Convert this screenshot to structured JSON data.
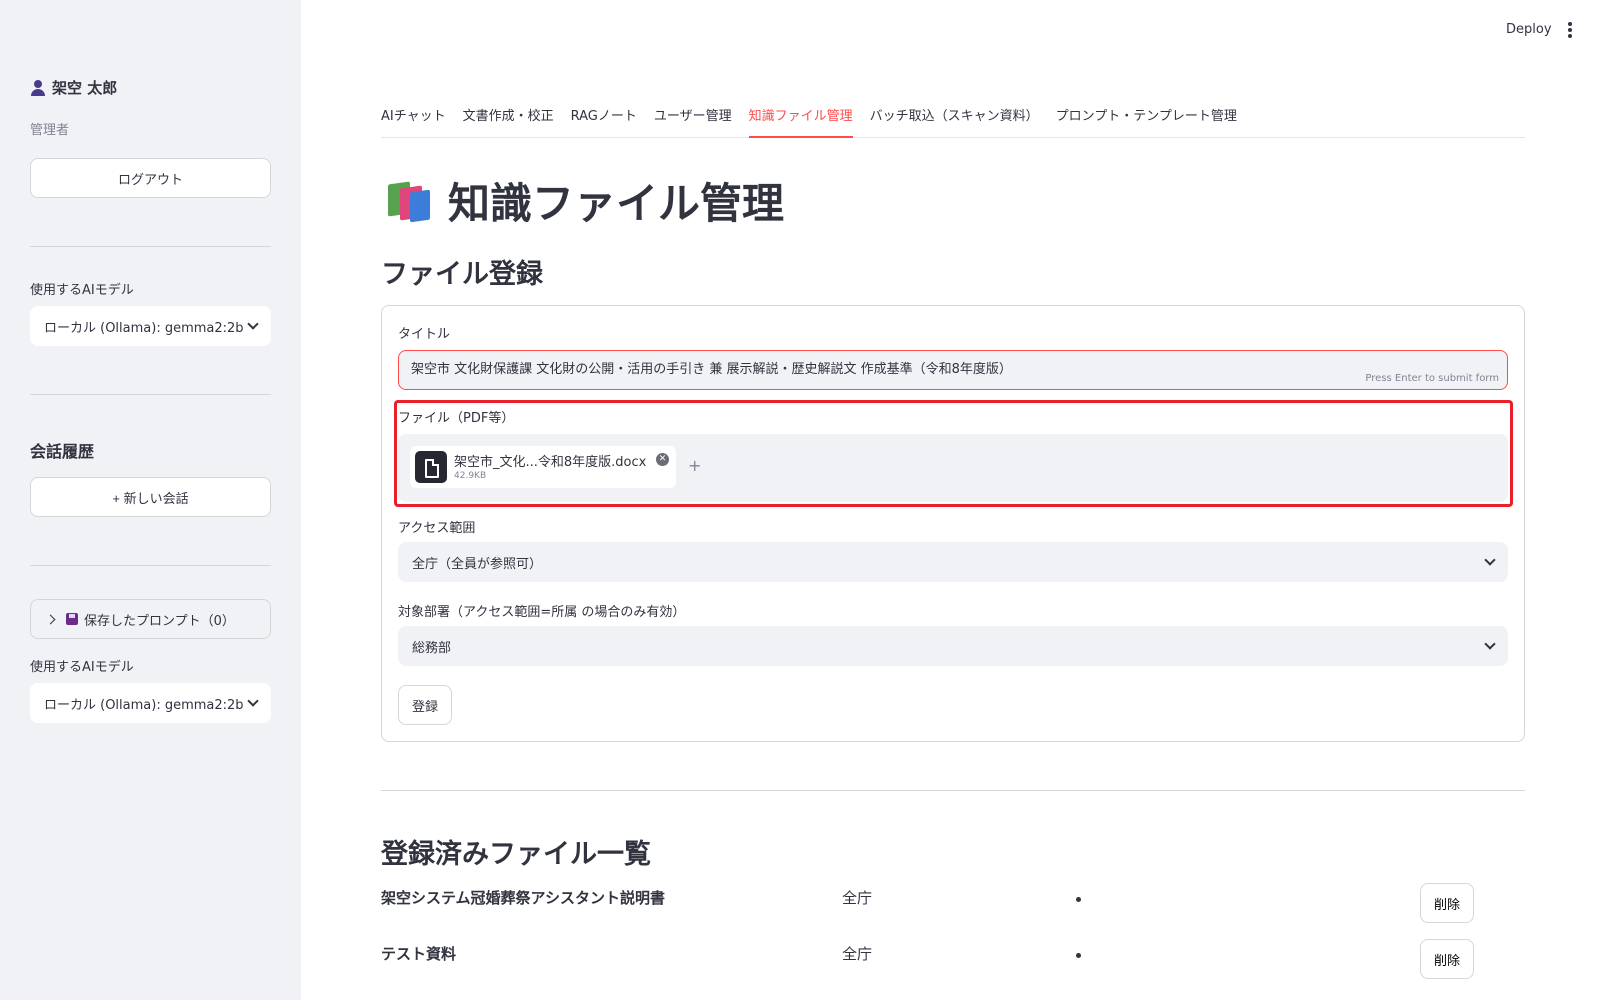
{
  "header": {
    "deploy_label": "Deploy"
  },
  "sidebar": {
    "user_name": "架空 太郎",
    "user_role": "管理者",
    "logout_label": "ログアウト",
    "model_label": "使用するAIモデル",
    "model_value": "ローカル (Ollama): gemma2:2b",
    "history_heading": "会話履歴",
    "new_chat_label": "+ 新しい会話",
    "saved_prompts_label": "保存したプロンプト（0）",
    "model_label_2": "使用するAIモデル",
    "model_value_2": "ローカル (Ollama): gemma2:2b"
  },
  "tabs": [
    {
      "label": "AIチャット",
      "active": false
    },
    {
      "label": "文書作成・校正",
      "active": false
    },
    {
      "label": "RAGノート",
      "active": false
    },
    {
      "label": "ユーザー管理",
      "active": false
    },
    {
      "label": "知識ファイル管理",
      "active": true
    },
    {
      "label": "バッチ取込（スキャン資料）",
      "active": false
    },
    {
      "label": "プロンプト・テンプレート管理",
      "active": false
    }
  ],
  "main": {
    "page_title": "知識ファイル管理",
    "register_heading": "ファイル登録",
    "form": {
      "title_label": "タイトル",
      "title_value": "架空市 文化財保護課 文化財の公開・活用の手引き 兼 展示解説・歴史解説文 作成基準（令和8年度版）",
      "title_hint": "Press Enter to submit form",
      "file_label": "ファイル（PDF等）",
      "file_name": "架空市_文化...令和8年度版.docx",
      "file_size": "42.9KB",
      "access_label": "アクセス範囲",
      "access_value": "全庁（全員が参照可）",
      "dept_label": "対象部署（アクセス範囲=所属 の場合のみ有効）",
      "dept_value": "総務部",
      "submit_label": "登録"
    },
    "list_heading": "登録済みファイル一覧",
    "files": [
      {
        "title": "架空システム冠婚葬祭アシスタント説明書",
        "scope": "全庁",
        "delete_label": "削除"
      },
      {
        "title": "テスト資料",
        "scope": "全庁",
        "delete_label": "削除"
      }
    ]
  },
  "colors": {
    "accent": "#ff4b4b",
    "highlight_border": "#e8202a",
    "sidebar_bg": "#f0f2f6"
  }
}
